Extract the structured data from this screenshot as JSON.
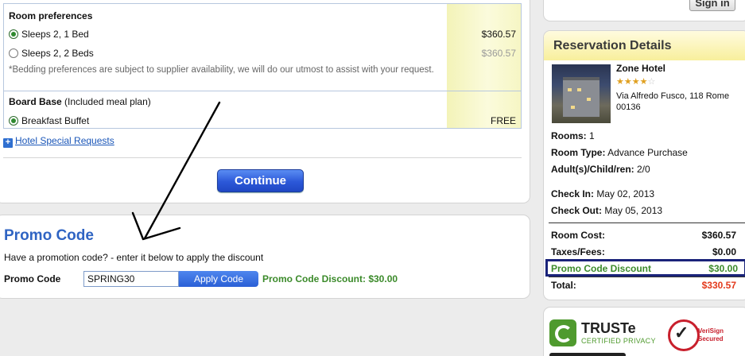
{
  "room_preferences": {
    "title": "Room preferences",
    "options": [
      {
        "label": "Sleeps 2, 1 Bed",
        "price": "$360.57",
        "selected": true
      },
      {
        "label": "Sleeps 2, 2 Beds",
        "price": "$360.57",
        "selected": false
      }
    ],
    "note": "*Bedding preferences are subject to supplier availability, we will do our utmost to assist with your request."
  },
  "board_base": {
    "title": "Board Base",
    "subtitle": "(Included meal plan)",
    "option_label": "Breakfast Buffet",
    "option_price": "FREE"
  },
  "special_requests_link": "Hotel Special Requests",
  "continue_label": "Continue",
  "promo": {
    "title": "Promo Code",
    "description": "Have a promotion code? - enter it below to apply the discount",
    "field_label": "Promo Code",
    "input_value": "SPRING30",
    "apply_label": "Apply Code",
    "result_text": "Promo Code Discount: $30.00"
  },
  "signin_label": "Sign in",
  "reservation": {
    "title": "Reservation Details",
    "hotel_name": "Zone Hotel",
    "star_rating": 4,
    "stars_filled": "★★★★",
    "stars_empty": "☆",
    "address": "Via Alfredo Fusco, 118 Rome 00136",
    "rooms_label": "Rooms:",
    "rooms_value": "1",
    "room_type_label": "Room Type:",
    "room_type_value": "Advance Purchase",
    "guests_label": "Adult(s)/Child/ren:",
    "guests_value": "2/0",
    "checkin_label": "Check In:",
    "checkin_value": "May 02, 2013",
    "checkout_label": "Check Out:",
    "checkout_value": "May 05, 2013",
    "room_cost_label": "Room Cost:",
    "room_cost_value": "$360.57",
    "taxes_label": "Taxes/Fees:",
    "taxes_value": "$0.00",
    "promo_label": "Promo Code Discount",
    "promo_value": "$30.00",
    "total_label": "Total:",
    "total_value": "$330.57"
  },
  "badges": {
    "truste_name": "TRUSTe",
    "truste_sub": "CERTIFIED PRIVACY",
    "verisign_line1": "VeriSign",
    "verisign_line2": "Secured"
  },
  "colors": {
    "accent_blue": "#2f64c3",
    "promo_green": "#3b8a2a",
    "total_red": "#e33a1c",
    "highlight_box": "#1a237a"
  }
}
